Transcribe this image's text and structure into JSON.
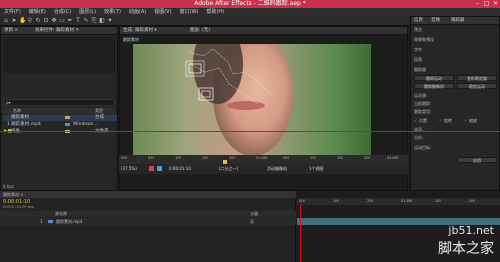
{
  "app": {
    "title": "Adobe After Effects - 二维码跟踪.aep *",
    "window_controls": [
      "–",
      "□",
      "×"
    ]
  },
  "menu": [
    "文件(F)",
    "编辑(E)",
    "合成(C)",
    "图层(L)",
    "效果(T)",
    "动画(A)",
    "视图(V)",
    "窗口(W)",
    "帮助(H)"
  ],
  "project_panel": {
    "tabs": [
      "项目 ×",
      "效果控件: 跟踪素材 ✕"
    ],
    "search_placeholder": "ρ▾",
    "columns": [
      "名称",
      "类型"
    ],
    "rows": [
      {
        "name": "跟踪素材",
        "type": "合成",
        "color": "#c9a85b"
      },
      {
        "name": "1 跟踪素材.mp4",
        "type": "Windows...",
        "color": "#5b8bc9"
      },
      {
        "name": "纯色",
        "type": "文件夹",
        "color": "#c9c45b"
      }
    ],
    "footer": "8 bpc"
  },
  "comp_panel": {
    "tabs": [
      "合成: 跟踪素材 ▾",
      "图层: (无)"
    ],
    "breadcrumb": "跟踪素材",
    "timecode_ruler": [
      "00f",
      "05f",
      "10f",
      "15f",
      "20f",
      "01:00f",
      "05f",
      "10f",
      "15f",
      "20f",
      "02:00f"
    ],
    "controls": {
      "zoom": "(37.5%)",
      "timecode": "0:00:01:10",
      "res": "(二分之一)",
      "camera": "活动摄像机",
      "view": "1个视图"
    }
  },
  "right_panel": {
    "tabs": [
      "信息",
      "音频",
      "跟踪器"
    ],
    "sections": [
      "预览",
      "效果和预设",
      "字符",
      "段落",
      "跟踪器"
    ],
    "buttons": [
      "跟踪运动",
      "变形稳定器",
      "跟踪摄像机",
      "稳定运动"
    ],
    "labels": {
      "source": "运动源:",
      "current": "当前跟踪:",
      "type": "跟踪类型:",
      "options": "选项...",
      "analyze": "分析:",
      "target": "运动目标:",
      "apply": "应用"
    },
    "checkboxes": [
      "位置",
      "旋转",
      "缩放"
    ]
  },
  "timeline": {
    "tab": "跟踪素材 ×",
    "timecode": "0:00:01:10",
    "fps": "00035 (25.00 fps)",
    "columns": [
      "源名称",
      "父级"
    ],
    "layers": [
      {
        "num": "1",
        "name": "跟踪素材.mp4",
        "parent": "无"
      }
    ],
    "ruler": [
      "00f",
      "10f",
      "20f",
      "01:00f",
      "10f",
      "20f"
    ]
  },
  "watermark": {
    "site": "jb51.net",
    "name": "脚本之家"
  }
}
